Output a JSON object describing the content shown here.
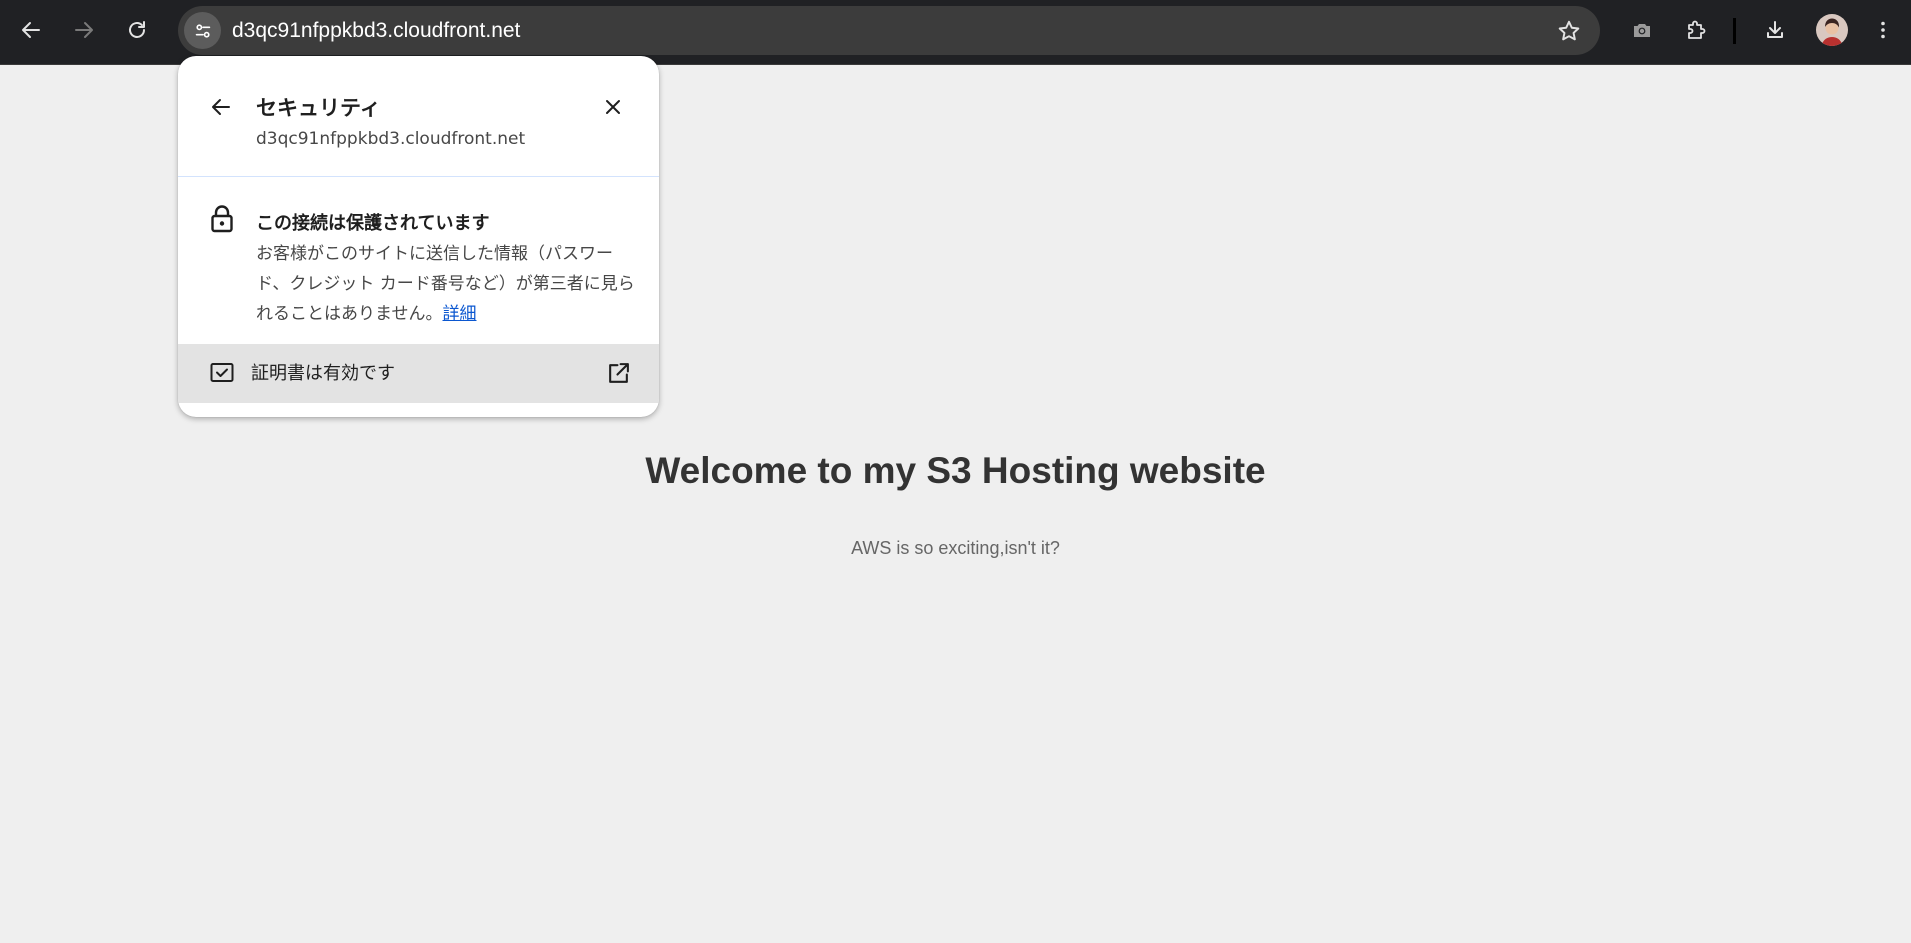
{
  "browser": {
    "url": "d3qc91nfppkbd3.cloudfront.net",
    "icons": {
      "back": "arrow-left-icon",
      "forward": "arrow-right-icon",
      "reload": "reload-icon",
      "site_info": "tune-icon",
      "bookmark": "star-icon",
      "screenshot": "camera-icon",
      "extensions": "puzzle-icon",
      "downloads": "download-icon",
      "menu": "kebab-menu-icon"
    },
    "colors": {
      "toolbar_bg": "#202124",
      "omnibox_bg": "#3c3c3c",
      "icon_active": "#e3e3e3",
      "icon_disabled": "#7a7a7a"
    }
  },
  "popup": {
    "title": "セキュリティ",
    "subtitle": "d3qc91nfppkbd3.cloudfront.net",
    "connection_title": "この接続は保護されています",
    "connection_desc": "お客様がこのサイトに送信した情報（パスワード、クレジット カード番号など）が第三者に見られることはありません。",
    "details_link": "詳細",
    "certificate_label": "証明書は有効です",
    "colors": {
      "link": "#0b57d0",
      "cert_row_bg": "#e3e3e3"
    }
  },
  "page": {
    "heading": "Welcome to my S3 Hosting website",
    "text": "AWS is so exciting,isn't it?",
    "colors": {
      "background": "#efefef",
      "heading": "#333333",
      "text": "#666666"
    }
  }
}
